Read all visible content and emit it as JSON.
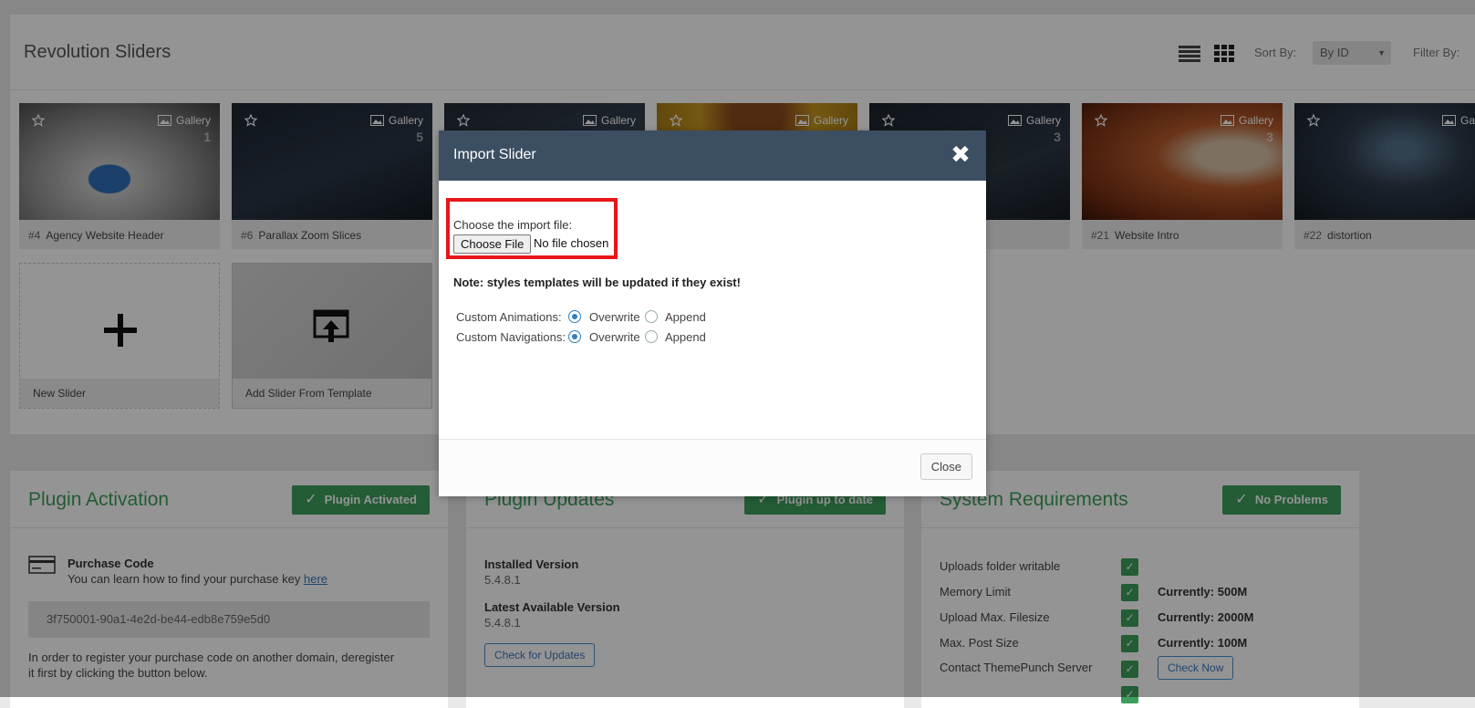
{
  "library": {
    "title": "Revolution Sliders",
    "sort_label": "Sort By:",
    "sort_value": "By ID",
    "filter_label": "Filter By:",
    "sliders": [
      {
        "id": "#4",
        "name": "Agency Website Header",
        "type": "Gallery",
        "count": "1"
      },
      {
        "id": "#6",
        "name": "Parallax Zoom Slices",
        "type": "Gallery",
        "count": "5"
      },
      {
        "id": "",
        "name": "",
        "type": "Gallery",
        "count": ""
      },
      {
        "id": "",
        "name": "",
        "type": "Gallery",
        "count": ""
      },
      {
        "id": "",
        "name": "",
        "type": "Gallery",
        "count": "3"
      },
      {
        "id": "#21",
        "name": "Website Intro",
        "type": "Gallery",
        "count": "3"
      },
      {
        "id": "#22",
        "name": "distortion",
        "type": "Galle",
        "count": ""
      }
    ],
    "new_slider_label": "New Slider",
    "add_template_label": "Add Slider From Template"
  },
  "activation": {
    "title": "Plugin Activation",
    "badge": "Plugin Activated",
    "purchase_title": "Purchase Code",
    "purchase_help": "You can learn how to find your purchase key",
    "purchase_link": "here",
    "purchase_code": "3f750001-90a1-4e2d-be44-edb8e759e5d0",
    "register_note_1": "In order to register your purchase code on another domain, deregister",
    "register_note_2": "it first by clicking the button below."
  },
  "updates": {
    "title": "Plugin Updates",
    "badge": "Plugin up to date",
    "installed_label": "Installed Version",
    "installed_value": "5.4.8.1",
    "latest_label": "Latest Available Version",
    "latest_value": "5.4.8.1",
    "check_button": "Check for Updates"
  },
  "requirements": {
    "title": "System Requirements",
    "badge": "No Problems",
    "rows": [
      {
        "label": "Uploads folder writable",
        "value": ""
      },
      {
        "label": "Memory Limit",
        "value": "Currently: 500M"
      },
      {
        "label": "Upload Max. Filesize",
        "value": "Currently: 2000M"
      },
      {
        "label": "Max. Post Size",
        "value": "Currently: 100M"
      },
      {
        "label": "Contact ThemePunch Server",
        "value": ""
      }
    ],
    "check_now": "Check Now"
  },
  "modal": {
    "title": "Import Slider",
    "file_label": "Choose the import file:",
    "file_button": "Choose File",
    "file_status": "No file chosen",
    "note": "Note: styles templates will be updated if they exist!",
    "animations_label": "Custom Animations:",
    "navigations_label": "Custom Navigations:",
    "overwrite": "Overwrite",
    "append": "Append",
    "close_button": "Close"
  },
  "colors": {
    "accent_green": "#3d9f5c",
    "modal_header": "#3c4e61",
    "highlight_red": "#e8161a"
  }
}
